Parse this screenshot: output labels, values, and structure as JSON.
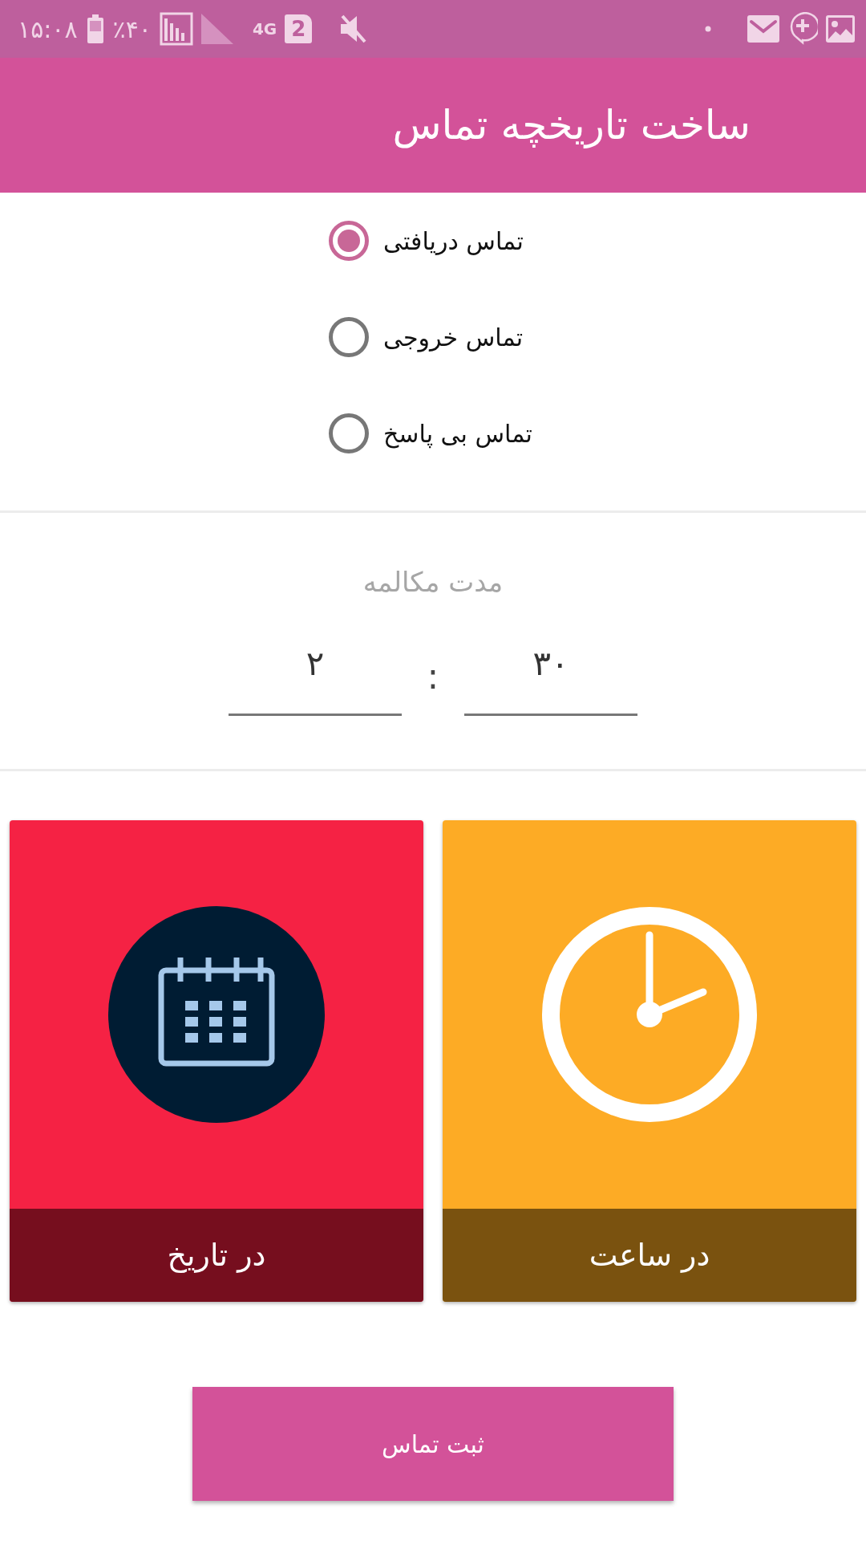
{
  "status_bar": {
    "time": "١۵:٠٨",
    "battery": "٪۴٠",
    "network": "4G",
    "sim": "2"
  },
  "app_bar": {
    "title": "ساخت تاریخچه تماس"
  },
  "call_types": [
    {
      "label": "تماس دریافتی",
      "selected": true
    },
    {
      "label": "تماس خروجی",
      "selected": false
    },
    {
      "label": "تماس بی پاسخ",
      "selected": false
    }
  ],
  "duration": {
    "label": "مدت مکالمه",
    "fields": [
      {
        "value": "٣٠"
      },
      {
        "value": "٢"
      }
    ],
    "separator": ":"
  },
  "cards": [
    {
      "kind": "clock",
      "label": "در ساعت",
      "color": "#fdab25"
    },
    {
      "kind": "calendar",
      "label": "در تاریخ",
      "color": "#f52244"
    }
  ],
  "submit": "ثبت تماس"
}
